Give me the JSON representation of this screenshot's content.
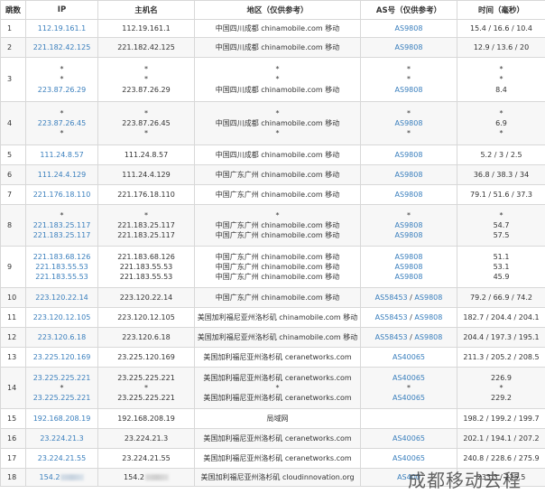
{
  "headers": {
    "hop": "跳数",
    "ip": "IP",
    "host": "主机名",
    "geo": "地区（仅供参考）",
    "as": "AS号（仅供参考）",
    "time": "时间（毫秒）"
  },
  "rows": [
    {
      "hop": "1",
      "ip": [
        "112.19.161.1"
      ],
      "host": [
        "112.19.161.1"
      ],
      "geo": [
        "中国四川成都 chinamobile.com 移动"
      ],
      "as": [
        [
          "AS9808"
        ]
      ],
      "time": [
        "15.4 / 16.6 / 10.4"
      ]
    },
    {
      "hop": "2",
      "ip": [
        "221.182.42.125"
      ],
      "host": [
        "221.182.42.125"
      ],
      "geo": [
        "中国四川成都 chinamobile.com 移动"
      ],
      "as": [
        [
          "AS9808"
        ]
      ],
      "time": [
        "12.9 / 13.6 / 20"
      ]
    },
    {
      "hop": "3",
      "ip": [
        "*",
        "*",
        "223.87.26.29"
      ],
      "host": [
        "*",
        "*",
        "223.87.26.29"
      ],
      "geo": [
        "*",
        "*",
        "中国四川成都 chinamobile.com 移动"
      ],
      "as": [
        [
          "*"
        ],
        [
          "*"
        ],
        [
          "AS9808"
        ]
      ],
      "time": [
        "*",
        "*",
        "8.4"
      ]
    },
    {
      "hop": "4",
      "ip": [
        "*",
        "223.87.26.45",
        "*"
      ],
      "host": [
        "*",
        "223.87.26.45",
        "*"
      ],
      "geo": [
        "*",
        "中国四川成都 chinamobile.com 移动",
        "*"
      ],
      "as": [
        [
          "*"
        ],
        [
          "AS9808"
        ],
        [
          "*"
        ]
      ],
      "time": [
        "*",
        "6.9",
        "*"
      ]
    },
    {
      "hop": "5",
      "ip": [
        "111.24.8.57"
      ],
      "host": [
        "111.24.8.57"
      ],
      "geo": [
        "中国四川成都 chinamobile.com 移动"
      ],
      "as": [
        [
          "AS9808"
        ]
      ],
      "time": [
        "5.2 / 3 / 2.5"
      ]
    },
    {
      "hop": "6",
      "ip": [
        "111.24.4.129"
      ],
      "host": [
        "111.24.4.129"
      ],
      "geo": [
        "中国广东广州 chinamobile.com 移动"
      ],
      "as": [
        [
          "AS9808"
        ]
      ],
      "time": [
        "36.8 / 38.3 / 34"
      ]
    },
    {
      "hop": "7",
      "ip": [
        "221.176.18.110"
      ],
      "host": [
        "221.176.18.110"
      ],
      "geo": [
        "中国广东广州 chinamobile.com 移动"
      ],
      "as": [
        [
          "AS9808"
        ]
      ],
      "time": [
        "79.1 / 51.6 / 37.3"
      ]
    },
    {
      "hop": "8",
      "ip": [
        "*",
        "221.183.25.117",
        "221.183.25.117"
      ],
      "host": [
        "*",
        "221.183.25.117",
        "221.183.25.117"
      ],
      "geo": [
        "*",
        "中国广东广州 chinamobile.com 移动",
        "中国广东广州 chinamobile.com 移动"
      ],
      "as": [
        [
          "*"
        ],
        [
          "AS9808"
        ],
        [
          "AS9808"
        ]
      ],
      "time": [
        "*",
        "54.7",
        "57.5"
      ]
    },
    {
      "hop": "9",
      "ip": [
        "221.183.68.126",
        "221.183.55.53",
        "221.183.55.53"
      ],
      "host": [
        "221.183.68.126",
        "221.183.55.53",
        "221.183.55.53"
      ],
      "geo": [
        "中国广东广州 chinamobile.com 移动",
        "中国广东广州 chinamobile.com 移动",
        "中国广东广州 chinamobile.com 移动"
      ],
      "as": [
        [
          "AS9808"
        ],
        [
          "AS9808"
        ],
        [
          "AS9808"
        ]
      ],
      "time": [
        "51.1",
        "53.1",
        "45.9"
      ]
    },
    {
      "hop": "10",
      "ip": [
        "223.120.22.14"
      ],
      "host": [
        "223.120.22.14"
      ],
      "geo": [
        "中国广东广州 chinamobile.com 移动"
      ],
      "as": [
        [
          "AS58453",
          "AS9808"
        ]
      ],
      "time": [
        "79.2 / 66.9 / 74.2"
      ]
    },
    {
      "hop": "11",
      "ip": [
        "223.120.12.105"
      ],
      "host": [
        "223.120.12.105"
      ],
      "geo": [
        "美国加利福尼亚州洛杉矶 chinamobile.com 移动"
      ],
      "as": [
        [
          "AS58453",
          "AS9808"
        ]
      ],
      "time": [
        "182.7 / 204.4 / 204.1"
      ]
    },
    {
      "hop": "12",
      "ip": [
        "223.120.6.18"
      ],
      "host": [
        "223.120.6.18"
      ],
      "geo": [
        "美国加利福尼亚州洛杉矶 chinamobile.com 移动"
      ],
      "as": [
        [
          "AS58453",
          "AS9808"
        ]
      ],
      "time": [
        "204.4 / 197.3 / 195.1"
      ]
    },
    {
      "hop": "13",
      "ip": [
        "23.225.120.169"
      ],
      "host": [
        "23.225.120.169"
      ],
      "geo": [
        "美国加利福尼亚州洛杉矶 ceranetworks.com"
      ],
      "as": [
        [
          "AS40065"
        ]
      ],
      "time": [
        "211.3 / 205.2 / 208.5"
      ]
    },
    {
      "hop": "14",
      "ip": [
        "23.225.225.221",
        "*",
        "23.225.225.221"
      ],
      "host": [
        "23.225.225.221",
        "*",
        "23.225.225.221"
      ],
      "geo": [
        "美国加利福尼亚州洛杉矶 ceranetworks.com",
        "*",
        "美国加利福尼亚州洛杉矶 ceranetworks.com"
      ],
      "as": [
        [
          "AS40065"
        ],
        [
          "*"
        ],
        [
          "AS40065"
        ]
      ],
      "time": [
        "226.9",
        "*",
        "229.2"
      ]
    },
    {
      "hop": "15",
      "ip": [
        "192.168.208.19"
      ],
      "host": [
        "192.168.208.19"
      ],
      "geo": [
        "局域网"
      ],
      "as": [
        []
      ],
      "time": [
        "198.2 / 199.2 / 199.7"
      ]
    },
    {
      "hop": "16",
      "ip": [
        "23.224.21.3"
      ],
      "host": [
        "23.224.21.3"
      ],
      "geo": [
        "美国加利福尼亚州洛杉矶 ceranetworks.com"
      ],
      "as": [
        [
          "AS40065"
        ]
      ],
      "time": [
        "202.1 / 194.1 / 207.2"
      ]
    },
    {
      "hop": "17",
      "ip": [
        "23.224.21.55"
      ],
      "host": [
        "23.224.21.55"
      ],
      "geo": [
        "美国加利福尼亚州洛杉矶 ceranetworks.com"
      ],
      "as": [
        [
          "AS40065"
        ]
      ],
      "time": [
        "240.8 / 228.6 / 275.9"
      ]
    },
    {
      "hop": "18",
      "ip": [
        "154.2"
      ],
      "host": [
        "154.2"
      ],
      "geo": [
        "美国加利福尼亚州洛杉矶 cloudinnovation.org"
      ],
      "as": [
        [
          "AS400"
        ]
      ],
      "time": [
        "233.3 / 225.5"
      ],
      "redacted": true
    }
  ],
  "watermark": "成都移动去程",
  "colors": {
    "link": "#3a7fbd",
    "text": "#333333",
    "border": "#d8d8d8",
    "stripe": "#f7f7f7"
  }
}
